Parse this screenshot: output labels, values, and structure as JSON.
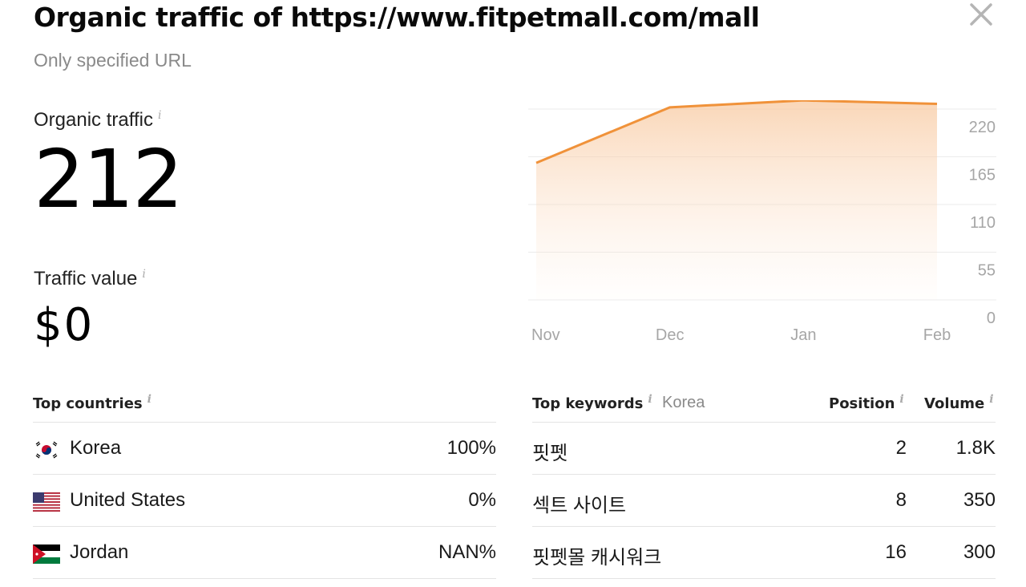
{
  "header": {
    "title": "Organic traffic of https://www.fitpetmall.com/mall",
    "subtitle": "Only specified URL"
  },
  "metrics": {
    "organic_traffic_label": "Organic traffic",
    "organic_traffic_value": "212",
    "traffic_value_label": "Traffic value",
    "traffic_value_value": "$0",
    "info_glyph": "i"
  },
  "chart_data": {
    "type": "area",
    "x": [
      "Nov",
      "Dec",
      "Jan",
      "Feb"
    ],
    "series": [
      {
        "values": [
          158,
          222,
          230,
          226
        ]
      }
    ],
    "y_ticks": [
      0,
      55,
      110,
      165,
      220
    ],
    "ylim": [
      0,
      220
    ],
    "y_axis_side": "right",
    "grid": true,
    "line_color": "#f0923a",
    "fill_color": "#fbd9bd"
  },
  "top_countries": {
    "header": "Top countries",
    "rows": [
      {
        "flag": "korea-flag-icon",
        "name": "Korea",
        "share": "100%"
      },
      {
        "flag": "usa-flag-icon",
        "name": "United States",
        "share": "0%"
      },
      {
        "flag": "jordan-flag-icon",
        "name": "Jordan",
        "share": "NAN%"
      }
    ]
  },
  "top_keywords": {
    "header": "Top keywords",
    "country": "Korea",
    "position_header": "Position",
    "volume_header": "Volume",
    "rows": [
      {
        "keyword": "핏펫",
        "position": "2",
        "volume": "1.8K"
      },
      {
        "keyword": "섹트 사이트",
        "position": "8",
        "volume": "350"
      },
      {
        "keyword": "핏펫몰 캐시워크",
        "position": "16",
        "volume": "300"
      }
    ]
  }
}
